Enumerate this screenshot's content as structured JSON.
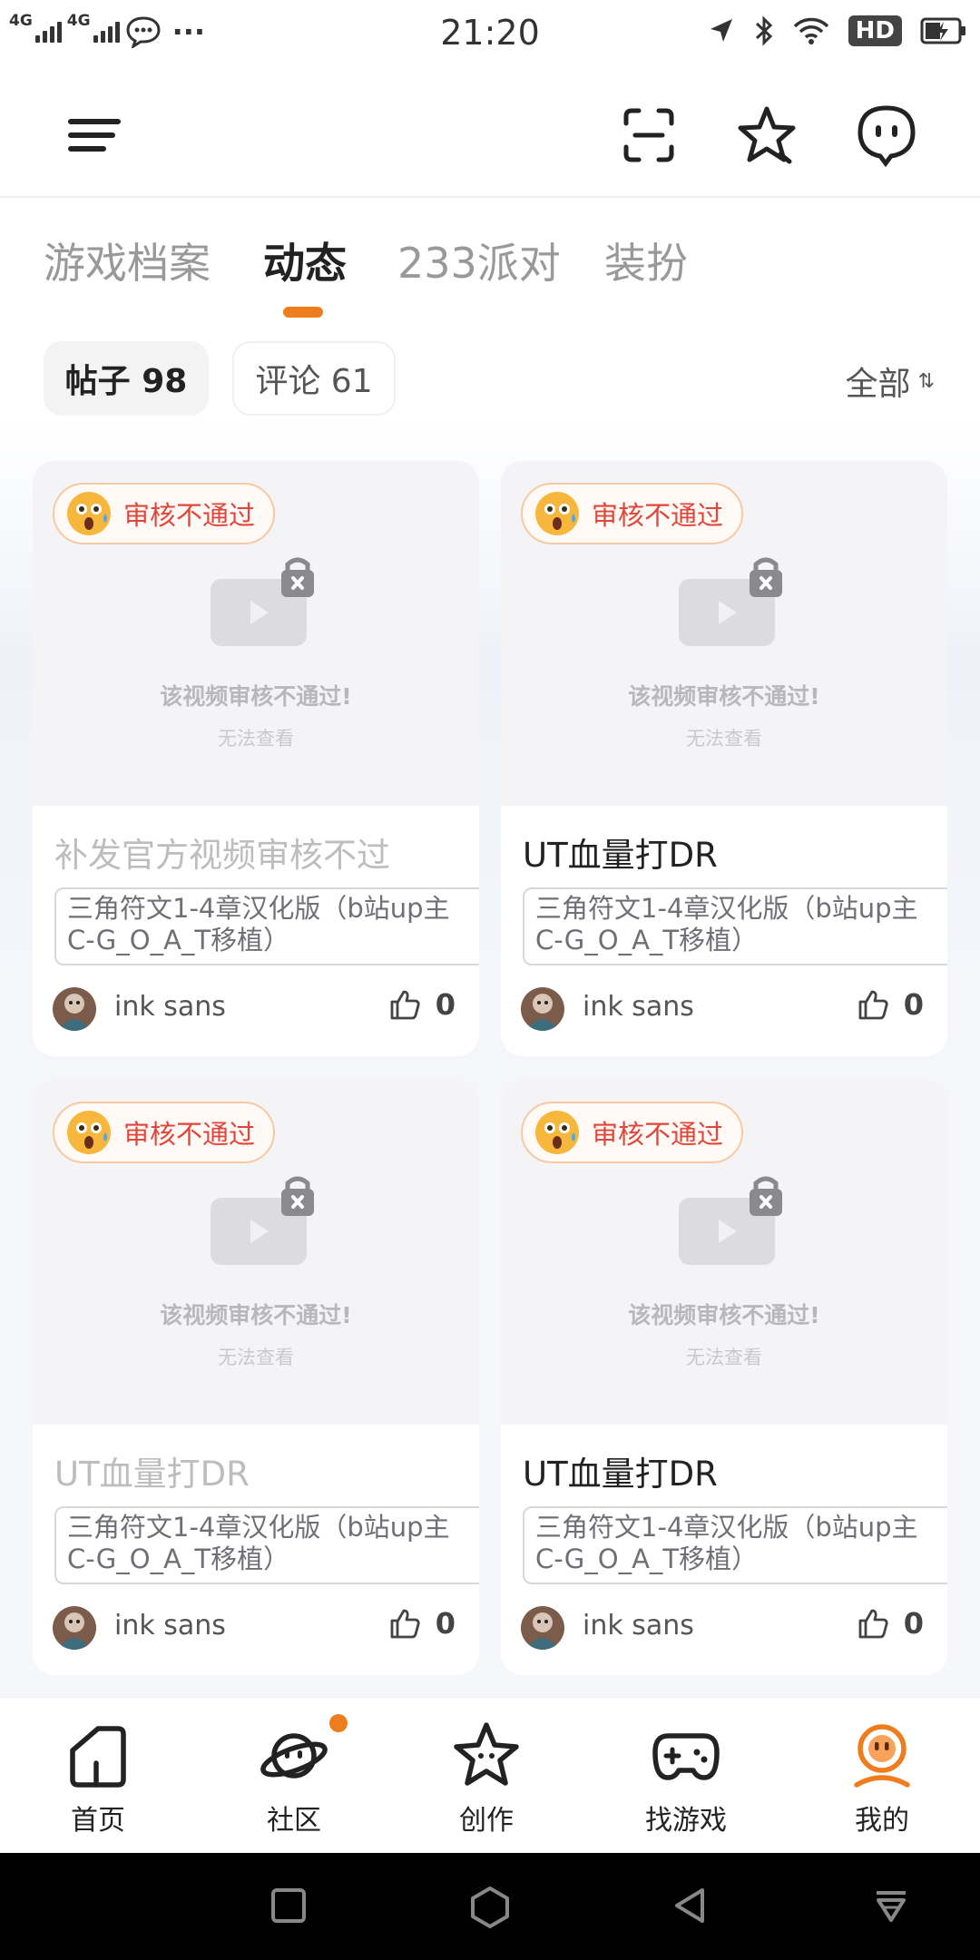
{
  "status_bar": {
    "net1": "4G",
    "net2": "4G",
    "more": "···",
    "time": "21:20",
    "hd": "HD"
  },
  "tabs": [
    {
      "label": "游戏档案"
    },
    {
      "label": "动态"
    },
    {
      "label": "233派对"
    },
    {
      "label": "装扮"
    }
  ],
  "filters": {
    "posts_label": "帖子 98",
    "comments_label": "评论 61",
    "sort_label": "全部",
    "sort_icon": "⇅"
  },
  "cards": [
    {
      "badge": "审核不通过",
      "media_msg": "该视频审核不通过!",
      "media_sub": "无法查看",
      "title": "补发官方视频审核不过",
      "tag": "三角符文1-4章汉化版（b站up主C-G_O_A_T移植）",
      "author": "ink sans",
      "likes": "0"
    },
    {
      "badge": "审核不通过",
      "media_msg": "该视频审核不通过!",
      "media_sub": "无法查看",
      "title": "UT血量打DR",
      "tag": "三角符文1-4章汉化版（b站up主C-G_O_A_T移植）",
      "author": "ink sans",
      "likes": "0"
    },
    {
      "badge": "审核不通过",
      "media_msg": "该视频审核不通过!",
      "media_sub": "无法查看",
      "title": "UT血量打DR",
      "tag": "三角符文1-4章汉化版（b站up主C-G_O_A_T移植）",
      "author": "ink sans",
      "likes": "0"
    },
    {
      "badge": "审核不通过",
      "media_msg": "该视频审核不通过!",
      "media_sub": "无法查看",
      "title": "UT血量打DR",
      "tag": "三角符文1-4章汉化版（b站up主C-G_O_A_T移植）",
      "author": "ink sans",
      "likes": "0"
    }
  ],
  "bottom_nav": [
    {
      "label": "首页",
      "icon": "home-icon"
    },
    {
      "label": "社区",
      "icon": "planet-icon"
    },
    {
      "label": "创作",
      "icon": "star-create-icon"
    },
    {
      "label": "找游戏",
      "icon": "gamepad-icon"
    },
    {
      "label": "我的",
      "icon": "profile-icon"
    }
  ],
  "colors": {
    "accent": "#f07d1d",
    "reject_red": "#e0463a",
    "badge_border": "#f6c9a2"
  }
}
